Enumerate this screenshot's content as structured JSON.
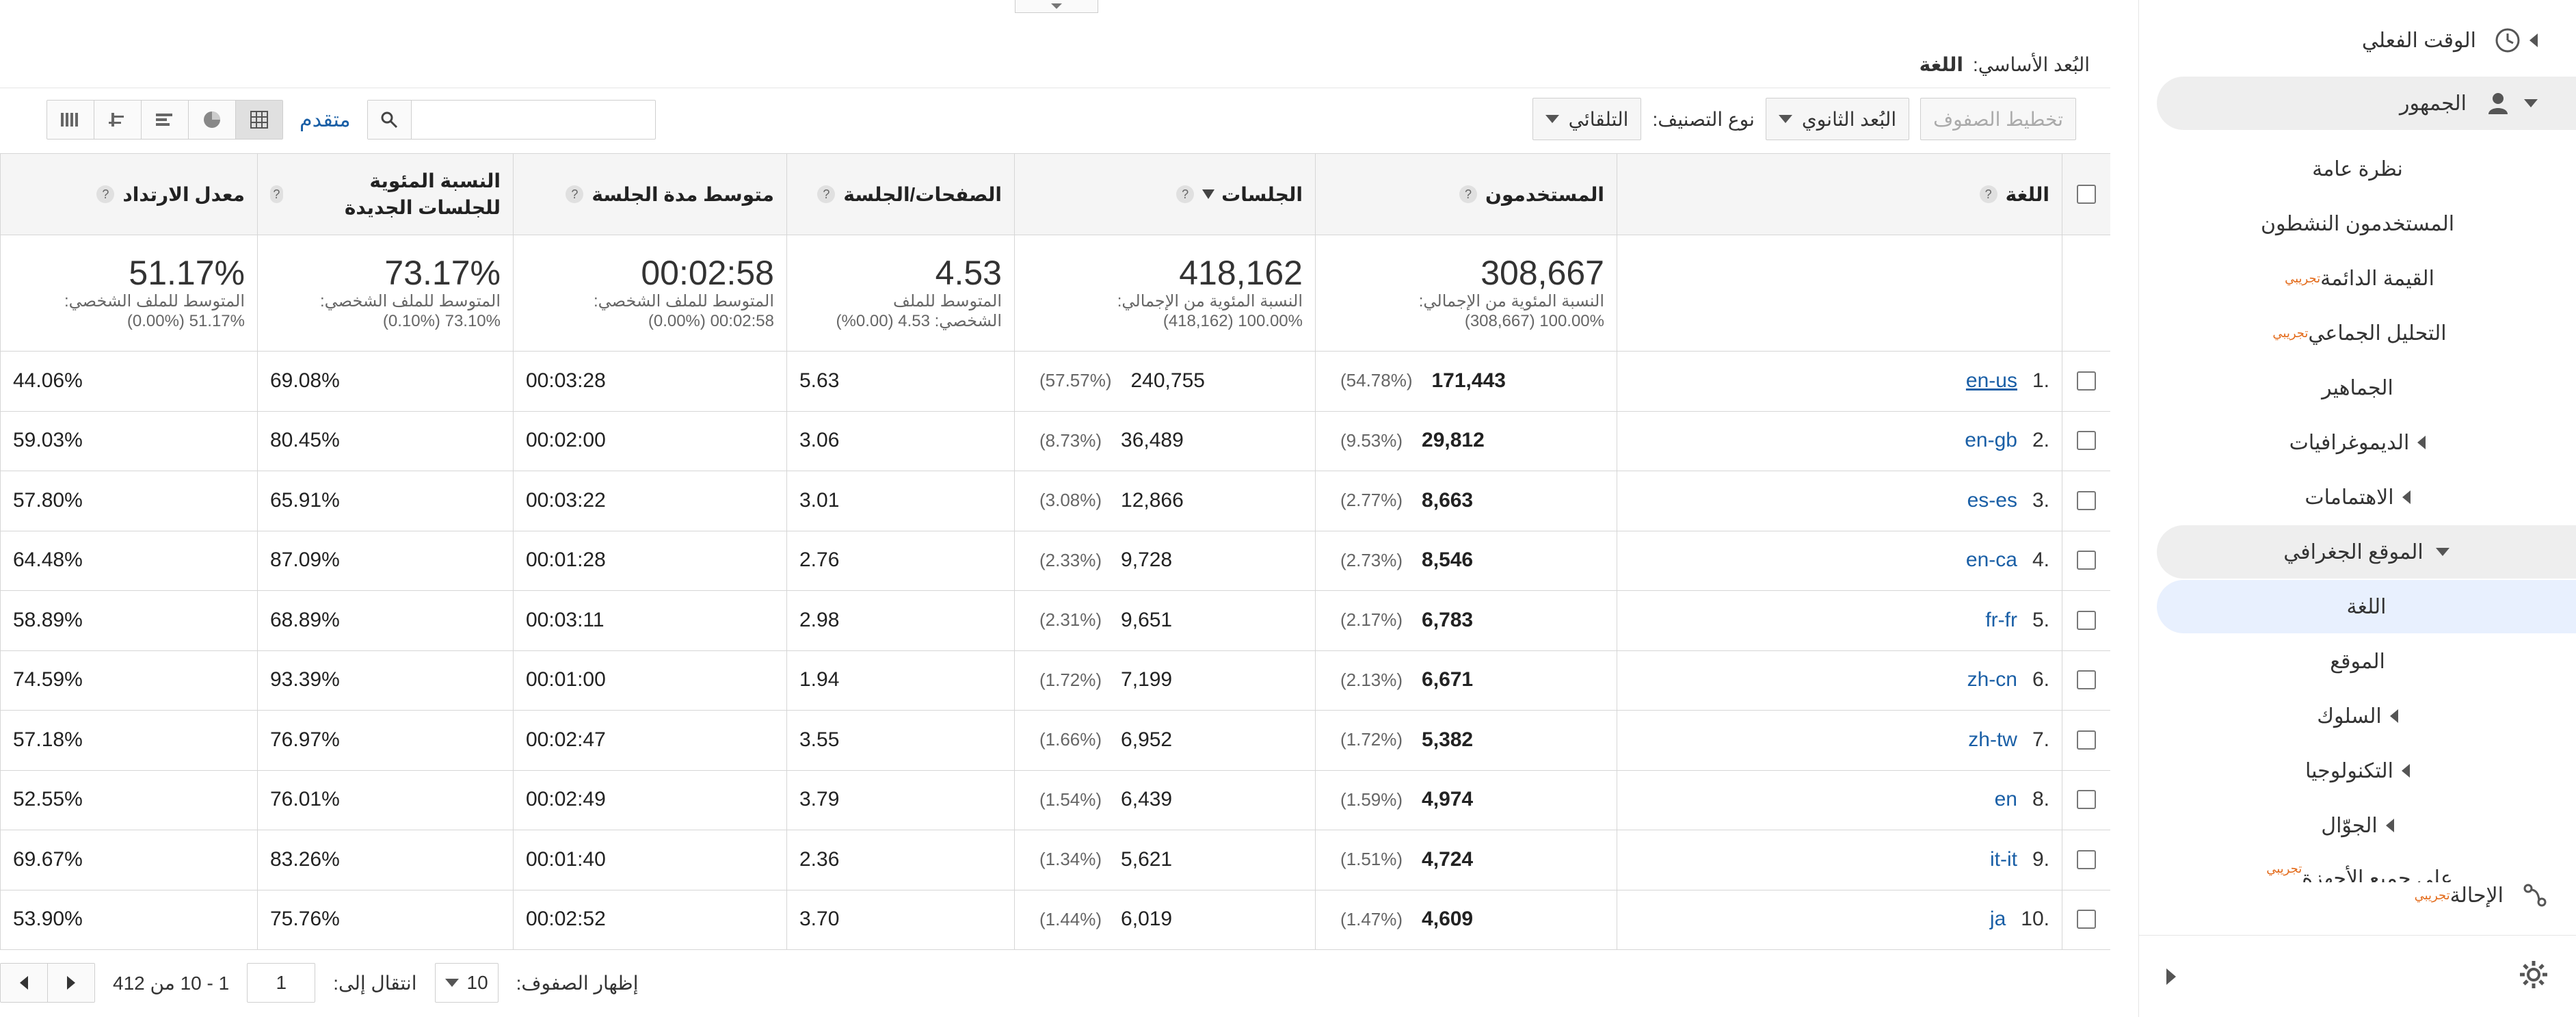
{
  "colors": {
    "accent": "#e36b1b",
    "link": "#1a5fa6",
    "active_bg": "#e8f0fe",
    "border": "#d6d6d6"
  },
  "sidebar": {
    "realtime": "الوقت الفعلي",
    "audience": "الجمهور",
    "items": [
      {
        "label": "نظرة عامة",
        "badge": ""
      },
      {
        "label": "المستخدمون النشطون",
        "badge": ""
      },
      {
        "label": "القيمة الدائمة",
        "badge": "تجريبي"
      },
      {
        "label": "التحليل الجماعي",
        "badge": "تجريبي"
      },
      {
        "label": "الجماهير",
        "badge": ""
      },
      {
        "label": "الديموغرافيات",
        "badge": ""
      },
      {
        "label": "الاهتمامات",
        "badge": ""
      },
      {
        "label": "الموقع الجغرافي",
        "badge": ""
      },
      {
        "label": "اللغة",
        "badge": ""
      },
      {
        "label": "الموقع",
        "badge": ""
      },
      {
        "label": "السلوك",
        "badge": ""
      },
      {
        "label": "التكنولوجيا",
        "badge": ""
      },
      {
        "label": "الجوّال",
        "badge": ""
      }
    ],
    "partial_label": "على جميع الأجهزة",
    "partial_badge": "تجريبي",
    "acquisition": {
      "label": "الإحالة",
      "badge": "تجريبي"
    }
  },
  "primary_dimension": {
    "label": "البُعد الأساسي:",
    "value": "اللغة"
  },
  "controls": {
    "plot_rows": "تخطيط الصفوف",
    "secondary_dimension": "البُعد الثانوي",
    "sort_type_label": "نوع التصنيف:",
    "sort_type_value": "التلقائي",
    "advanced": "متقدم",
    "search_placeholder": ""
  },
  "table": {
    "headers": {
      "language": "اللغة",
      "users": "المستخدمون",
      "sessions": "الجلسات",
      "pages_session": "الصفحات/الجلسة",
      "avg_duration": "متوسط مدة الجلسة",
      "new_sessions": "النسبة المئوية للجلسات الجديدة",
      "bounce": "معدل الارتداد"
    },
    "totals": {
      "users": {
        "value": "308,667",
        "line1": "النسبة المئوية من الإجمالي:",
        "line2": "100.00% (308,667)"
      },
      "sessions": {
        "value": "418,162",
        "line1": "النسبة المئوية من الإجمالي:",
        "line2": "100.00% (418,162)"
      },
      "pages_session": {
        "value": "4.53",
        "line1": "المتوسط للملف",
        "line2": "الشخصي: 4.53 (0.00%)"
      },
      "avg_duration": {
        "value": "00:02:58",
        "line1": "المتوسط للملف الشخصي:",
        "line2": "00:02:58 (0.00%)"
      },
      "new_sessions": {
        "value": "73.17%",
        "line1": "المتوسط للملف الشخصي:",
        "line2": "73.10% (0.10%)"
      },
      "bounce": {
        "value": "51.17%",
        "line1": "المتوسط للملف الشخصي:",
        "line2": "51.17% (0.00%)"
      }
    },
    "rows": [
      {
        "num": "1.",
        "lang": "en-us",
        "users": "171,443",
        "users_pct": "(54.78%)",
        "sessions": "240,755",
        "sessions_pct": "(57.57%)",
        "pps": "5.63",
        "dur": "00:03:28",
        "new": "69.08%",
        "bounce": "44.06%"
      },
      {
        "num": "2.",
        "lang": "en-gb",
        "users": "29,812",
        "users_pct": "(9.53%)",
        "sessions": "36,489",
        "sessions_pct": "(8.73%)",
        "pps": "3.06",
        "dur": "00:02:00",
        "new": "80.45%",
        "bounce": "59.03%"
      },
      {
        "num": "3.",
        "lang": "es-es",
        "users": "8,663",
        "users_pct": "(2.77%)",
        "sessions": "12,866",
        "sessions_pct": "(3.08%)",
        "pps": "3.01",
        "dur": "00:03:22",
        "new": "65.91%",
        "bounce": "57.80%"
      },
      {
        "num": "4.",
        "lang": "en-ca",
        "users": "8,546",
        "users_pct": "(2.73%)",
        "sessions": "9,728",
        "sessions_pct": "(2.33%)",
        "pps": "2.76",
        "dur": "00:01:28",
        "new": "87.09%",
        "bounce": "64.48%"
      },
      {
        "num": "5.",
        "lang": "fr-fr",
        "users": "6,783",
        "users_pct": "(2.17%)",
        "sessions": "9,651",
        "sessions_pct": "(2.31%)",
        "pps": "2.98",
        "dur": "00:03:11",
        "new": "68.89%",
        "bounce": "58.89%"
      },
      {
        "num": "6.",
        "lang": "zh-cn",
        "users": "6,671",
        "users_pct": "(2.13%)",
        "sessions": "7,199",
        "sessions_pct": "(1.72%)",
        "pps": "1.94",
        "dur": "00:01:00",
        "new": "93.39%",
        "bounce": "74.59%"
      },
      {
        "num": "7.",
        "lang": "zh-tw",
        "users": "5,382",
        "users_pct": "(1.72%)",
        "sessions": "6,952",
        "sessions_pct": "(1.66%)",
        "pps": "3.55",
        "dur": "00:02:47",
        "new": "76.97%",
        "bounce": "57.18%"
      },
      {
        "num": "8.",
        "lang": "en",
        "users": "4,974",
        "users_pct": "(1.59%)",
        "sessions": "6,439",
        "sessions_pct": "(1.54%)",
        "pps": "3.79",
        "dur": "00:02:49",
        "new": "76.01%",
        "bounce": "52.55%"
      },
      {
        "num": "9.",
        "lang": "it-it",
        "users": "4,724",
        "users_pct": "(1.51%)",
        "sessions": "5,621",
        "sessions_pct": "(1.34%)",
        "pps": "2.36",
        "dur": "00:01:40",
        "new": "83.26%",
        "bounce": "69.67%"
      },
      {
        "num": "10.",
        "lang": "ja",
        "users": "4,609",
        "users_pct": "(1.47%)",
        "sessions": "6,019",
        "sessions_pct": "(1.44%)",
        "pps": "3.70",
        "dur": "00:02:52",
        "new": "75.76%",
        "bounce": "53.90%"
      }
    ]
  },
  "pagination": {
    "show_rows_label": "إظهار الصفوف:",
    "rows_value": "10",
    "goto_label": "انتقال إلى:",
    "goto_value": "1",
    "range": "1 - 10 من 412"
  }
}
